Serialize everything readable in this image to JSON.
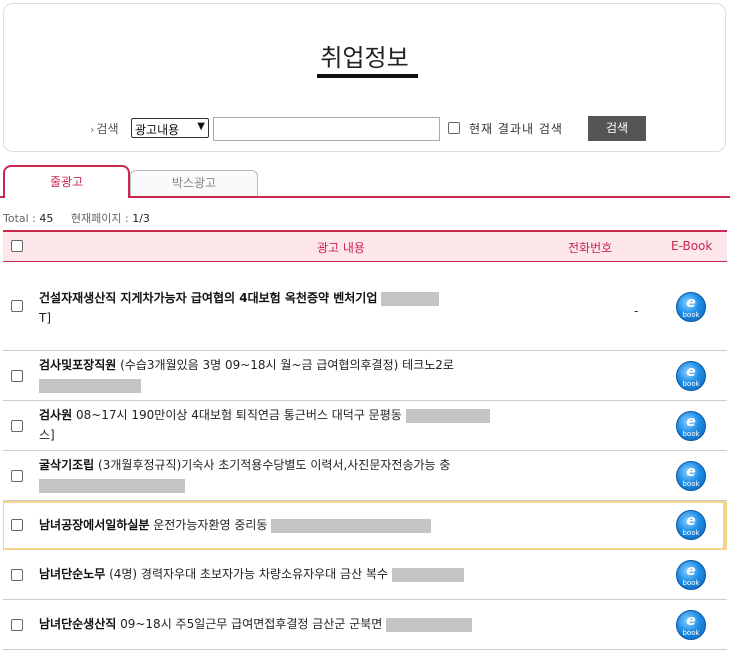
{
  "header": {
    "title": "취업정보",
    "search_label": "검색",
    "search_select": "광고내용",
    "search_value": "",
    "within_label": "현재 결과내 검색",
    "search_button": "검색"
  },
  "tabs": [
    {
      "label": "줄광고",
      "active": true
    },
    {
      "label": "박스광고",
      "active": false
    }
  ],
  "summary": {
    "total_label": "Total :",
    "total_value": "45",
    "page_label": "현재페이지 :",
    "page_value": "1/3"
  },
  "table": {
    "columns": [
      "광고 내용",
      "전화번호",
      "E-Book"
    ],
    "rows": [
      {
        "bold": "건설자재생산직 지게차가능자 급여협의 4대보험 옥천증약 벤처기업",
        "text": "",
        "tail": "T]",
        "phone": "-"
      },
      {
        "bold": "검사및포장직원",
        "text": " (수습3개월있음 3명 09~18시 월~금 급여협의후결정) 테크노2로",
        "tail": "",
        "phone": ""
      },
      {
        "bold": "검사원",
        "text": " 08~17시 190만이상 4대보험 퇴직연금 통근버스 대덕구 문평동",
        "tail": "스]",
        "phone": ""
      },
      {
        "bold": "굴삭기조립",
        "text": " (3개월후정규직)기숙사 초기적용수당별도 이력서,사진문자전송가능 충",
        "tail": "",
        "phone": ""
      },
      {
        "bold": "남녀공장에서일하실분",
        "text": " 운전가능자환영 중리동",
        "tail": "",
        "phone": ""
      },
      {
        "bold": "남녀단순노무",
        "text": " (4명) 경력자우대 초보자가능 차량소유자우대 금산 복수",
        "tail": "",
        "phone": ""
      },
      {
        "bold": "남녀단순생산직",
        "text": " 09~18시 주5일근무 급여면접후결정 금산군 군북면",
        "tail": "",
        "phone": ""
      }
    ],
    "ebook_icon": "ebook-icon"
  },
  "colors": {
    "accent": "#c8294f",
    "header_bg": "#fde7ea",
    "highlight": "#f5d58a"
  }
}
